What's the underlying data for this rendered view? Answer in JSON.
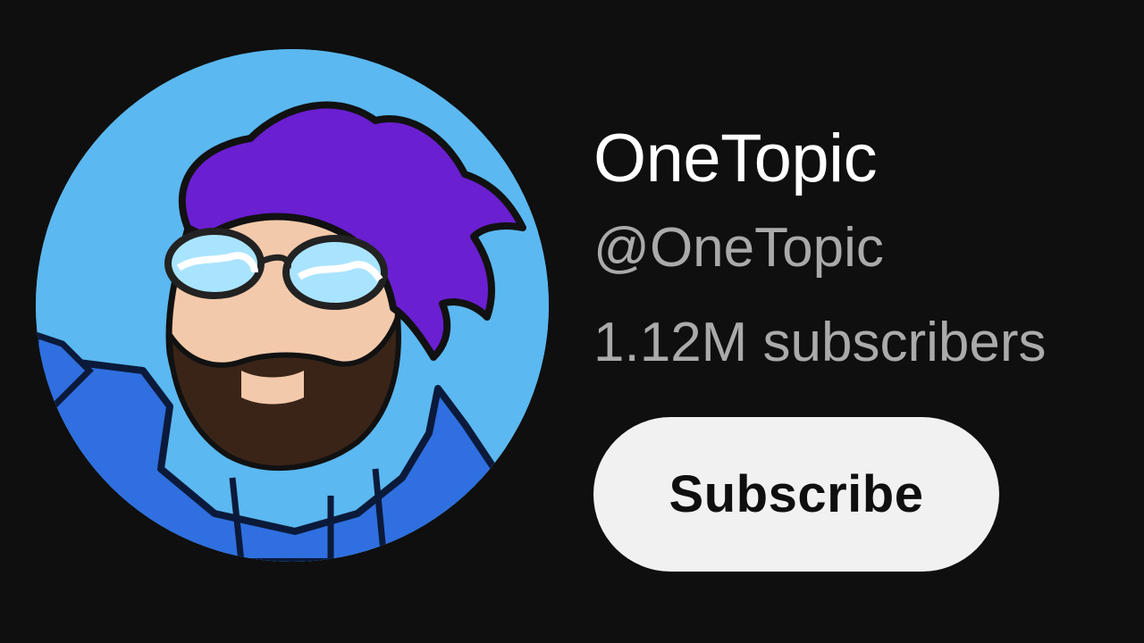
{
  "channel": {
    "name": "OneTopic",
    "handle": "@OneTopic",
    "subscribers": "1.12M subscribers"
  },
  "actions": {
    "subscribe_label": "Subscribe"
  },
  "avatar": {
    "icon": "cartoon-avatar-icon",
    "background": "#5bb8f0",
    "hair": "#6a1fd1",
    "hoodie": "#2f6fe0",
    "beard": "#3a2418",
    "skin": "#f3c9ab"
  },
  "colors": {
    "page_background": "#0f0f0f",
    "name_text": "#ffffff",
    "secondary_text": "#aaaaaa",
    "button_background": "#f1f1f1",
    "button_text": "#0f0f0f"
  }
}
